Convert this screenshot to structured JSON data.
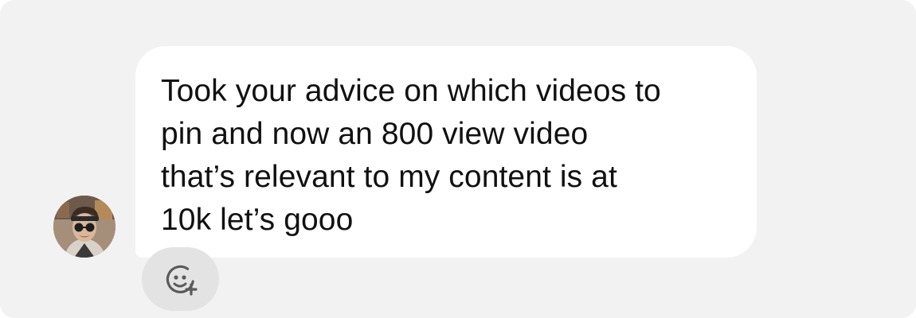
{
  "message": {
    "text": "Took your advice on which videos to\npin and now an 800 view video\nthat’s relevant to my content is at\n10k let’s gooo"
  },
  "sender": {
    "avatar_icon": "profile-photo"
  },
  "reaction": {
    "icon": "add-reaction-icon"
  },
  "colors": {
    "background": "#f2f2f2",
    "bubble": "#ffffff",
    "reaction_button": "#e3e3e3",
    "text": "#111111"
  }
}
